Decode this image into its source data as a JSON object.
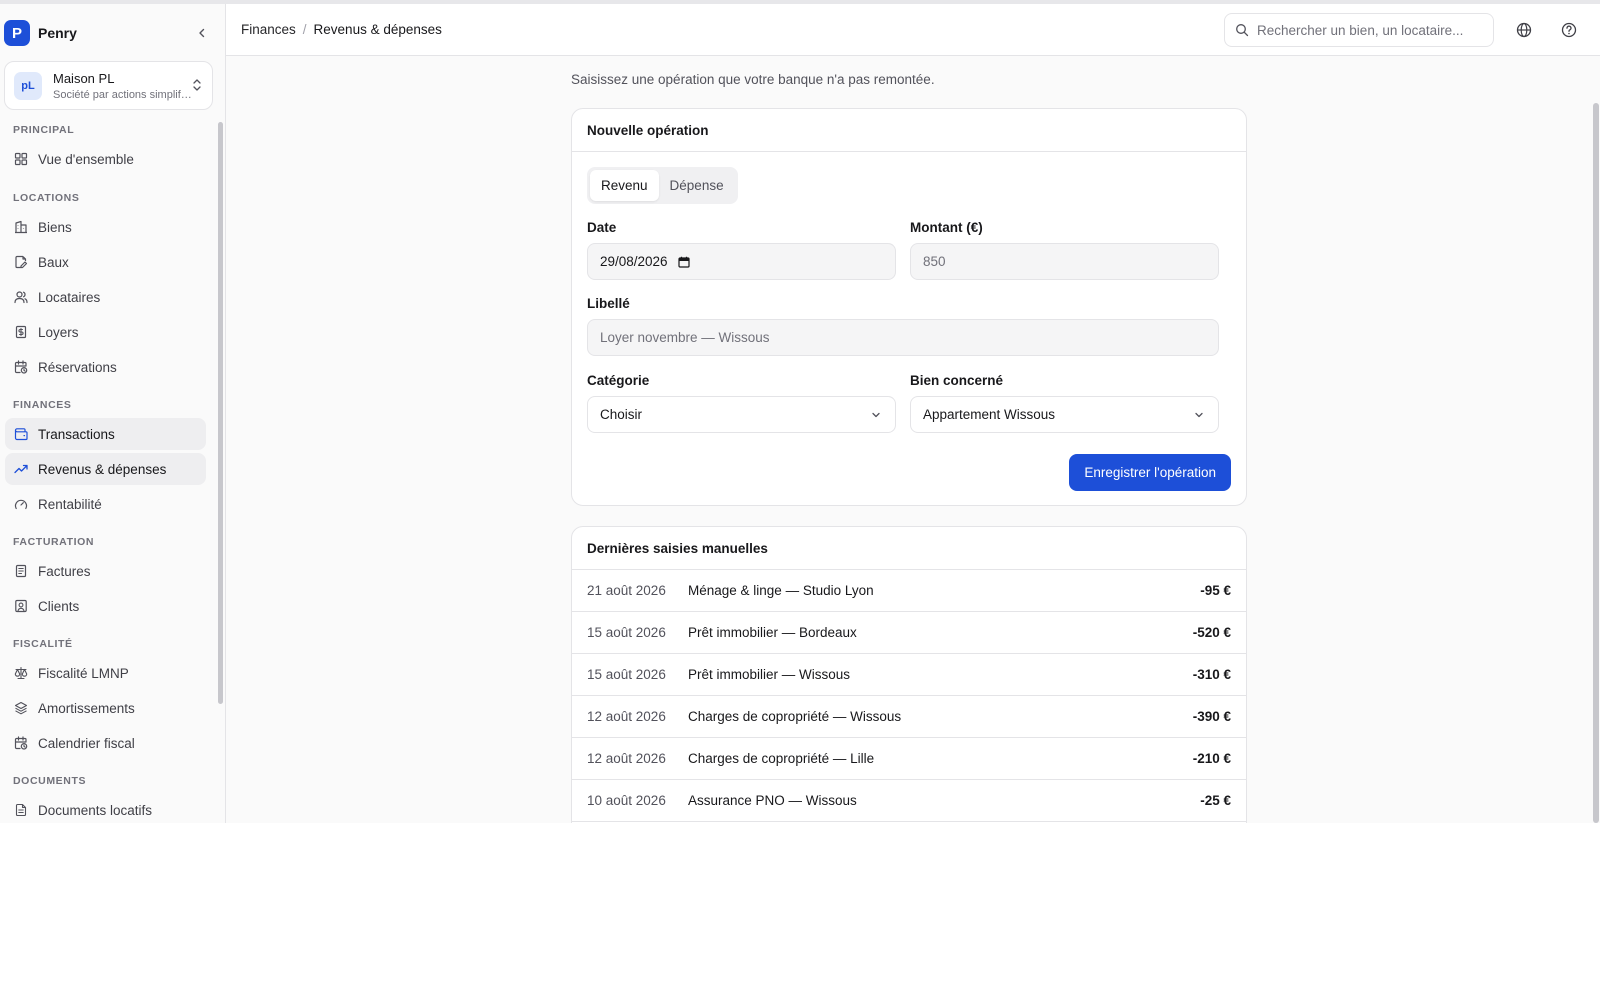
{
  "brand": {
    "logo_letter": "P",
    "name": "Penry"
  },
  "org": {
    "avatar": "pL",
    "name": "Maison PL",
    "subtitle": "Société par actions simplifiée"
  },
  "sidebar": {
    "sections": {
      "principal": "PRINCIPAL",
      "locations": "LOCATIONS",
      "finances": "FINANCES",
      "facturation": "FACTURATION",
      "fiscalite": "FISCALITÉ",
      "documents": "DOCUMENTS"
    },
    "items": {
      "overview": "Vue d'ensemble",
      "biens": "Biens",
      "baux": "Baux",
      "locataires": "Locataires",
      "loyers": "Loyers",
      "reservations": "Réservations",
      "transactions": "Transactions",
      "revenus": "Revenus & dépenses",
      "rentabilite": "Rentabilité",
      "factures": "Factures",
      "clients": "Clients",
      "fiscalite_lmnp": "Fiscalité LMNP",
      "amortissements": "Amortissements",
      "calendrier": "Calendrier fiscal",
      "documents_locatifs": "Documents locatifs"
    }
  },
  "header": {
    "breadcrumb": [
      "Finances",
      "Revenus & dépenses"
    ],
    "search_placeholder": "Rechercher un bien, un locataire..."
  },
  "page": {
    "subtitle": "Saisissez une opération que votre banque n'a pas remontée."
  },
  "form": {
    "title": "Nouvelle opération",
    "tabs": [
      "Revenu",
      "Dépense"
    ],
    "date_label": "Date",
    "date_value": "29/08/2026",
    "amount_label": "Montant (€)",
    "amount_placeholder": "850",
    "libelle_label": "Libellé",
    "libelle_placeholder": "Loyer novembre — Wissous",
    "category_label": "Catégorie",
    "category_value": "Choisir",
    "property_label": "Bien concerné",
    "property_value": "Appartement Wissous",
    "submit_label": "Enregistrer l'opération"
  },
  "recent": {
    "title": "Dernières saisies manuelles",
    "rows": [
      {
        "date": "21 août 2026",
        "label": "Ménage & linge — Studio Lyon",
        "amount": "-95 €"
      },
      {
        "date": "15 août 2026",
        "label": "Prêt immobilier — Bordeaux",
        "amount": "-520 €"
      },
      {
        "date": "15 août 2026",
        "label": "Prêt immobilier — Wissous",
        "amount": "-310 €"
      },
      {
        "date": "12 août 2026",
        "label": "Charges de copropriété — Wissous",
        "amount": "-390 €"
      },
      {
        "date": "12 août 2026",
        "label": "Charges de copropriété — Lille",
        "amount": "-210 €"
      },
      {
        "date": "10 août 2026",
        "label": "Assurance PNO — Wissous",
        "amount": "-25 €"
      }
    ]
  },
  "colors": {
    "accent": "#1d4fd8",
    "sidebar_bg": "#fafafa",
    "border": "#e4e4e7"
  }
}
